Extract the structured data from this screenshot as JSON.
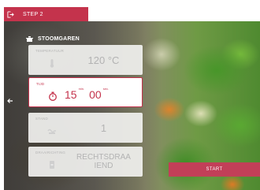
{
  "header": {
    "step_label": "STEP 2"
  },
  "program": {
    "title": "STOOMGAREN"
  },
  "settings": {
    "temperature": {
      "label": "TEMPERATUUR",
      "value": "120 °C"
    },
    "time": {
      "label": "TIJD",
      "minutes": "15",
      "minutes_unit": "min.",
      "seconds": "00",
      "seconds_unit": "sec."
    },
    "level": {
      "label": "STAND",
      "value": "1"
    },
    "rotation": {
      "label": "DRAAIRICHTING",
      "value_line1": "RECHTSDRAA",
      "value_line2": "IEND"
    }
  },
  "actions": {
    "start_label": "START"
  },
  "colors": {
    "accent": "#c4334c",
    "start_button": "#c23f58",
    "inactive_text": "#b3b3b3"
  },
  "icons": {
    "exit": "exit-icon",
    "back": "back-arrow-icon",
    "program": "steam-pot-icon",
    "temperature": "thermometer-icon",
    "time": "timer-icon",
    "level": "level-icon",
    "rotation": "rotation-icon"
  }
}
